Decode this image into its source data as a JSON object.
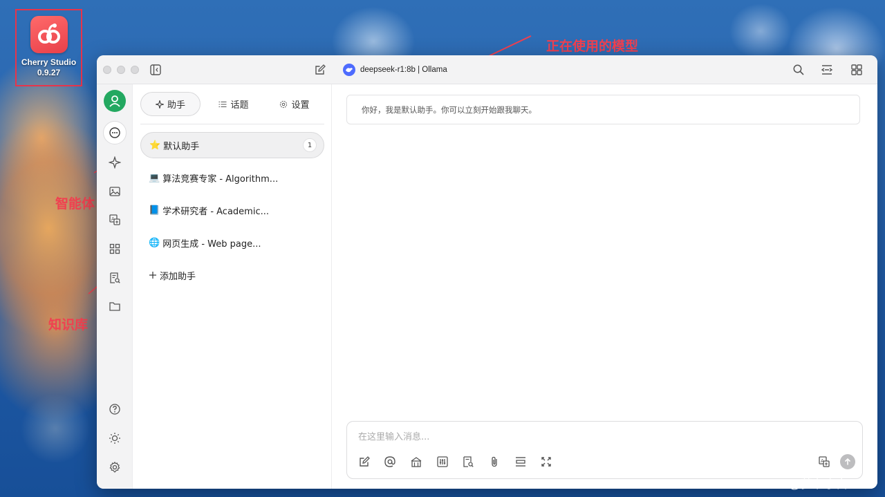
{
  "desktop": {
    "app_name": "Cherry Studio",
    "app_version": "0.9.27"
  },
  "annotations": {
    "model": "正在使用的模型",
    "agent": "智能体",
    "knowledge": "知识库"
  },
  "titlebar": {
    "model": "deepseek-r1:8b | Ollama"
  },
  "panel": {
    "tabs": [
      {
        "label": "助手",
        "icon": "sparkle-icon"
      },
      {
        "label": "话题",
        "icon": "list-icon"
      },
      {
        "label": "设置",
        "icon": "gear-icon"
      }
    ],
    "assistants": [
      {
        "emoji": "⭐",
        "label": "默认助手",
        "badge": "1"
      },
      {
        "emoji": "💻",
        "label": "算法竞赛专家 - Algorithm..."
      },
      {
        "emoji": "📘",
        "label": "学术研究者 - Academic..."
      },
      {
        "emoji": "🌐",
        "label": "网页生成 - Web page..."
      }
    ],
    "add_label": "添加助手"
  },
  "chat": {
    "welcome": "你好，我是默认助手。你可以立刻开始跟我聊天。",
    "input_placeholder": "在这里输入消息..."
  },
  "watermark": "CSDN @萝卜小白",
  "colors": {
    "accent_red": "#f04050",
    "avatar_green": "#23a860",
    "deepseek_blue": "#4d6bfe"
  }
}
